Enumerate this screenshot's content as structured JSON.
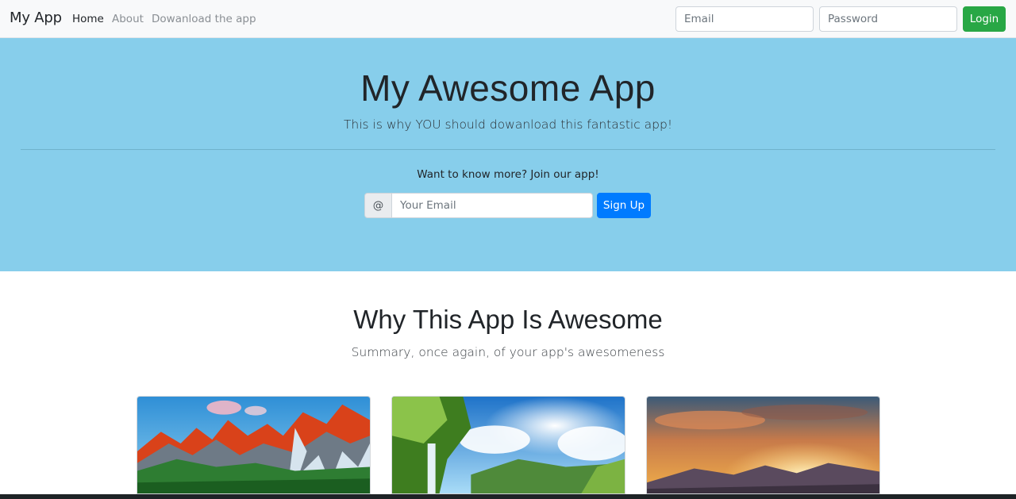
{
  "navbar": {
    "brand": "My App",
    "links": [
      {
        "label": "Home",
        "active": true
      },
      {
        "label": "About",
        "active": false
      },
      {
        "label": "Dowanload the app",
        "active": false
      }
    ],
    "email_placeholder": "Email",
    "password_placeholder": "Password",
    "login_label": "Login"
  },
  "hero": {
    "title": "My Awesome App",
    "subtitle": "This is why YOU should dowanload this fantastic app!",
    "join_text": "Want to know more? Join our app!",
    "email_prefix": "@",
    "email_placeholder": "Your Email",
    "signup_label": "Sign Up",
    "background_color": "#87ceeb"
  },
  "features": {
    "title": "Why This App Is Awesome",
    "subtitle": "Summary, once again, of your app's awesomeness",
    "cards": [
      {
        "image": "mountain-landscape-image"
      },
      {
        "image": "waterfall-valley-image"
      },
      {
        "image": "sunset-mountains-image"
      }
    ]
  },
  "colors": {
    "login_button": "#28a745",
    "signup_button": "#007bff",
    "navbar_bg": "#f8f9fa"
  }
}
